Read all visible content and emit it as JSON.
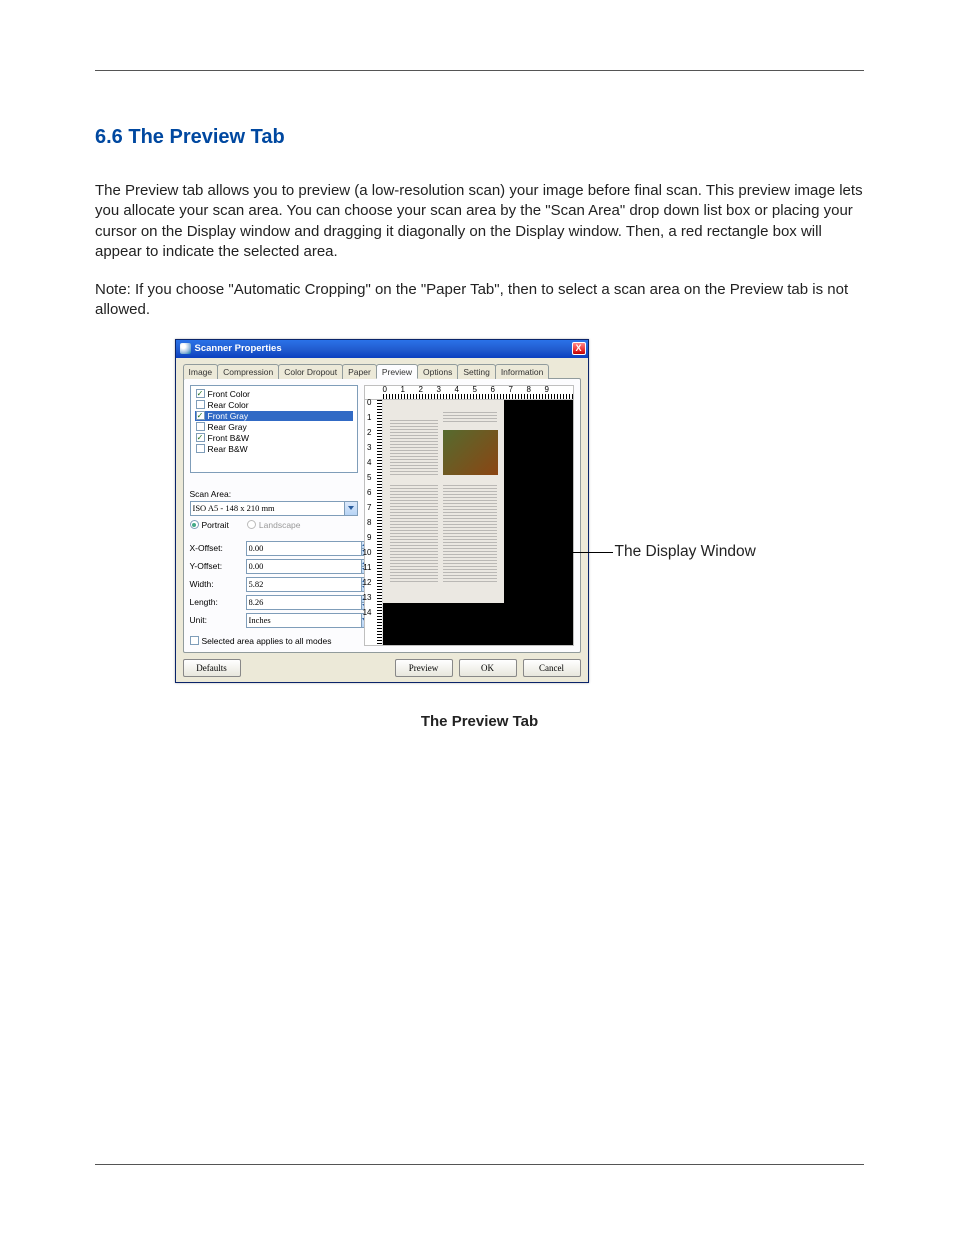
{
  "section": {
    "title": "6.6  The Preview Tab",
    "para1": "The Preview tab allows you to preview (a low-resolution scan) your image before final scan. This preview image lets you allocate your scan area. You can choose your scan area by the \"Scan Area\" drop down list box or placing your cursor on the Display window and dragging it diagonally on the Display window. Then, a red rectangle box will appear to indicate the selected area.",
    "para2": "Note: If you choose \"Automatic Cropping\" on the \"Paper Tab\", then to select a scan area on the Preview tab is not allowed."
  },
  "callout": "The Display Window",
  "caption": "The Preview Tab",
  "dialog": {
    "title": "Scanner Properties",
    "tabs": [
      "Image",
      "Compression",
      "Color Dropout",
      "Paper",
      "Preview",
      "Options",
      "Setting",
      "Information"
    ],
    "active_tab_index": 4,
    "modes": [
      {
        "label": "Front Color",
        "checked": true,
        "selected": false
      },
      {
        "label": "Rear Color",
        "checked": false,
        "selected": false
      },
      {
        "label": "Front Gray",
        "checked": true,
        "selected": true
      },
      {
        "label": "Rear Gray",
        "checked": false,
        "selected": false
      },
      {
        "label": "Front B&W",
        "checked": true,
        "selected": false
      },
      {
        "label": "Rear B&W",
        "checked": false,
        "selected": false
      }
    ],
    "scan_area_label": "Scan Area:",
    "scan_area_value": "ISO A5 - 148 x 210 mm",
    "orientation": {
      "portrait": "Portrait",
      "landscape": "Landscape",
      "selected": "portrait"
    },
    "xoffset_label": "X-Offset:",
    "xoffset": "0.00",
    "yoffset_label": "Y-Offset:",
    "yoffset": "0.00",
    "width_label": "Width:",
    "width": "5.82",
    "length_label": "Length:",
    "length": "8.26",
    "unit_label": "Unit:",
    "unit": "Inches",
    "applies_label": "Selected area applies to all modes",
    "ruler_h": [
      "0",
      "1",
      "2",
      "3",
      "4",
      "5",
      "6",
      "7",
      "8",
      "9"
    ],
    "ruler_v": [
      "0",
      "1",
      "2",
      "3",
      "4",
      "5",
      "6",
      "7",
      "8",
      "9",
      "10",
      "11",
      "12",
      "13",
      "14"
    ],
    "buttons": {
      "defaults": "Defaults",
      "preview": "Preview",
      "ok": "OK",
      "cancel": "Cancel"
    }
  }
}
